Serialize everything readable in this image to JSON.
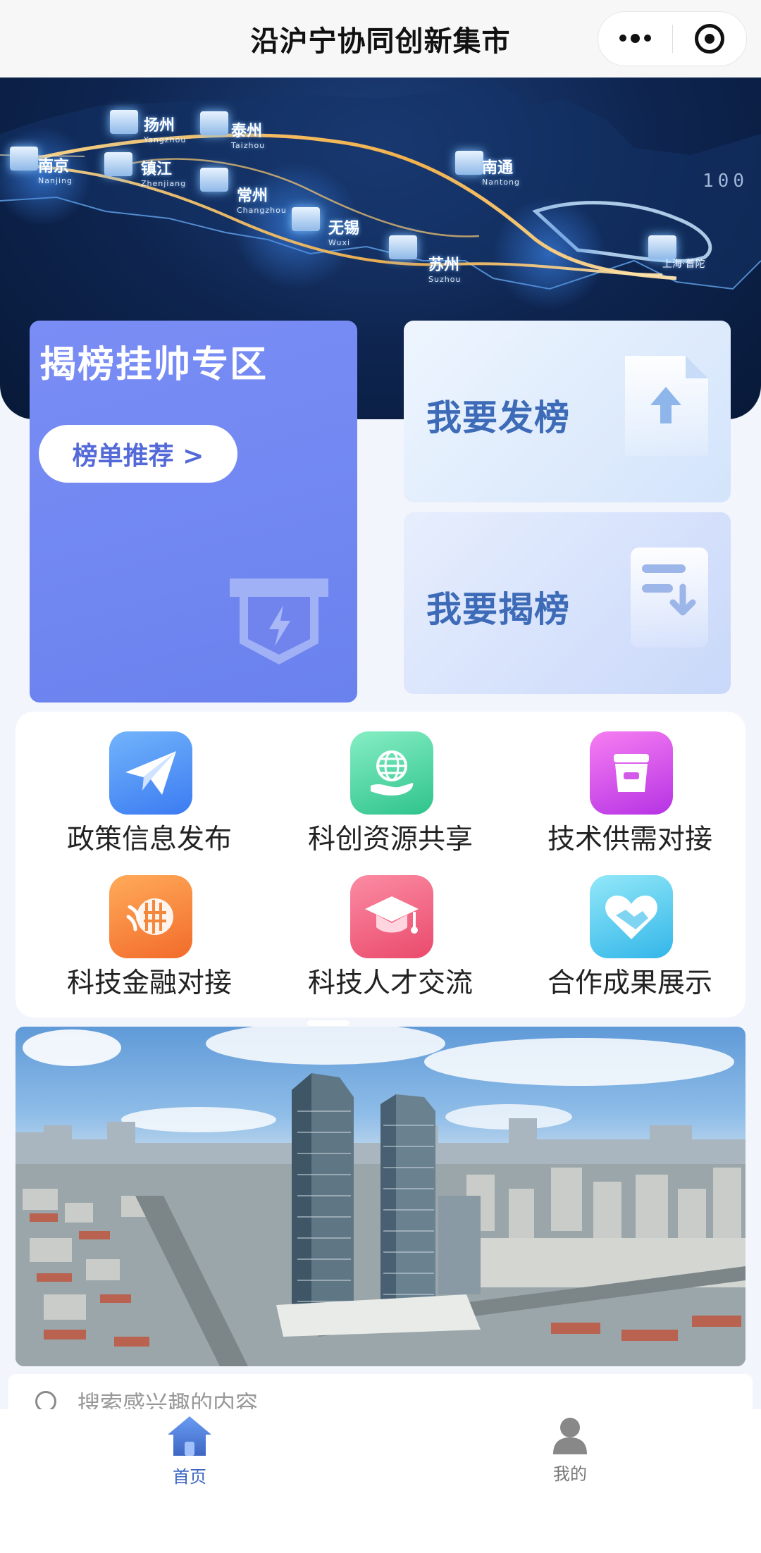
{
  "navbar": {
    "title": "沿沪宁协同创新集市"
  },
  "hero": {
    "cities": [
      {
        "name": "扬州",
        "pinyin": "Yangzhou"
      },
      {
        "name": "泰州",
        "pinyin": "Taizhou"
      },
      {
        "name": "南京",
        "pinyin": "Nanjing"
      },
      {
        "name": "镇江",
        "pinyin": "Zhenjiang"
      },
      {
        "name": "常州",
        "pinyin": "Changzhou"
      },
      {
        "name": "无锡",
        "pinyin": "Wuxi"
      },
      {
        "name": "南通",
        "pinyin": "Nantong"
      },
      {
        "name": "苏州",
        "pinyin": "Suzhou"
      },
      {
        "name": "上海·普陀",
        "pinyin": ""
      }
    ],
    "scale_text": "100"
  },
  "zone": {
    "title": "揭榜挂帅专区",
    "button": "榜单推荐 >"
  },
  "cards": {
    "post": "我要发榜",
    "take": "我要揭榜"
  },
  "services": [
    {
      "label": "政策信息发布",
      "icon": "paper-plane-icon",
      "color_from": "#6fb2fb",
      "color_to": "#3b7cf3"
    },
    {
      "label": "科创资源共享",
      "icon": "globe-hand-icon",
      "color_from": "#7fe9c0",
      "color_to": "#2fc48e"
    },
    {
      "label": "技术供需对接",
      "icon": "box-icon",
      "color_from": "#f477f0",
      "color_to": "#b935e6"
    },
    {
      "label": "科技金融对接",
      "icon": "finance-icon",
      "color_from": "#ffa856",
      "color_to": "#f36d2b"
    },
    {
      "label": "科技人才交流",
      "icon": "graduation-cap-icon",
      "color_from": "#fb8aa2",
      "color_to": "#eb4d70"
    },
    {
      "label": "合作成果展示",
      "icon": "handshake-heart-icon",
      "color_from": "#8ee6f7",
      "color_to": "#35b8ea"
    }
  ],
  "search": {
    "placeholder": "搜索感兴趣的内容"
  },
  "tabbar": {
    "home": "首页",
    "mine": "我的"
  },
  "colors": {
    "accent": "#3d67c3",
    "zone": "#7083ef"
  }
}
